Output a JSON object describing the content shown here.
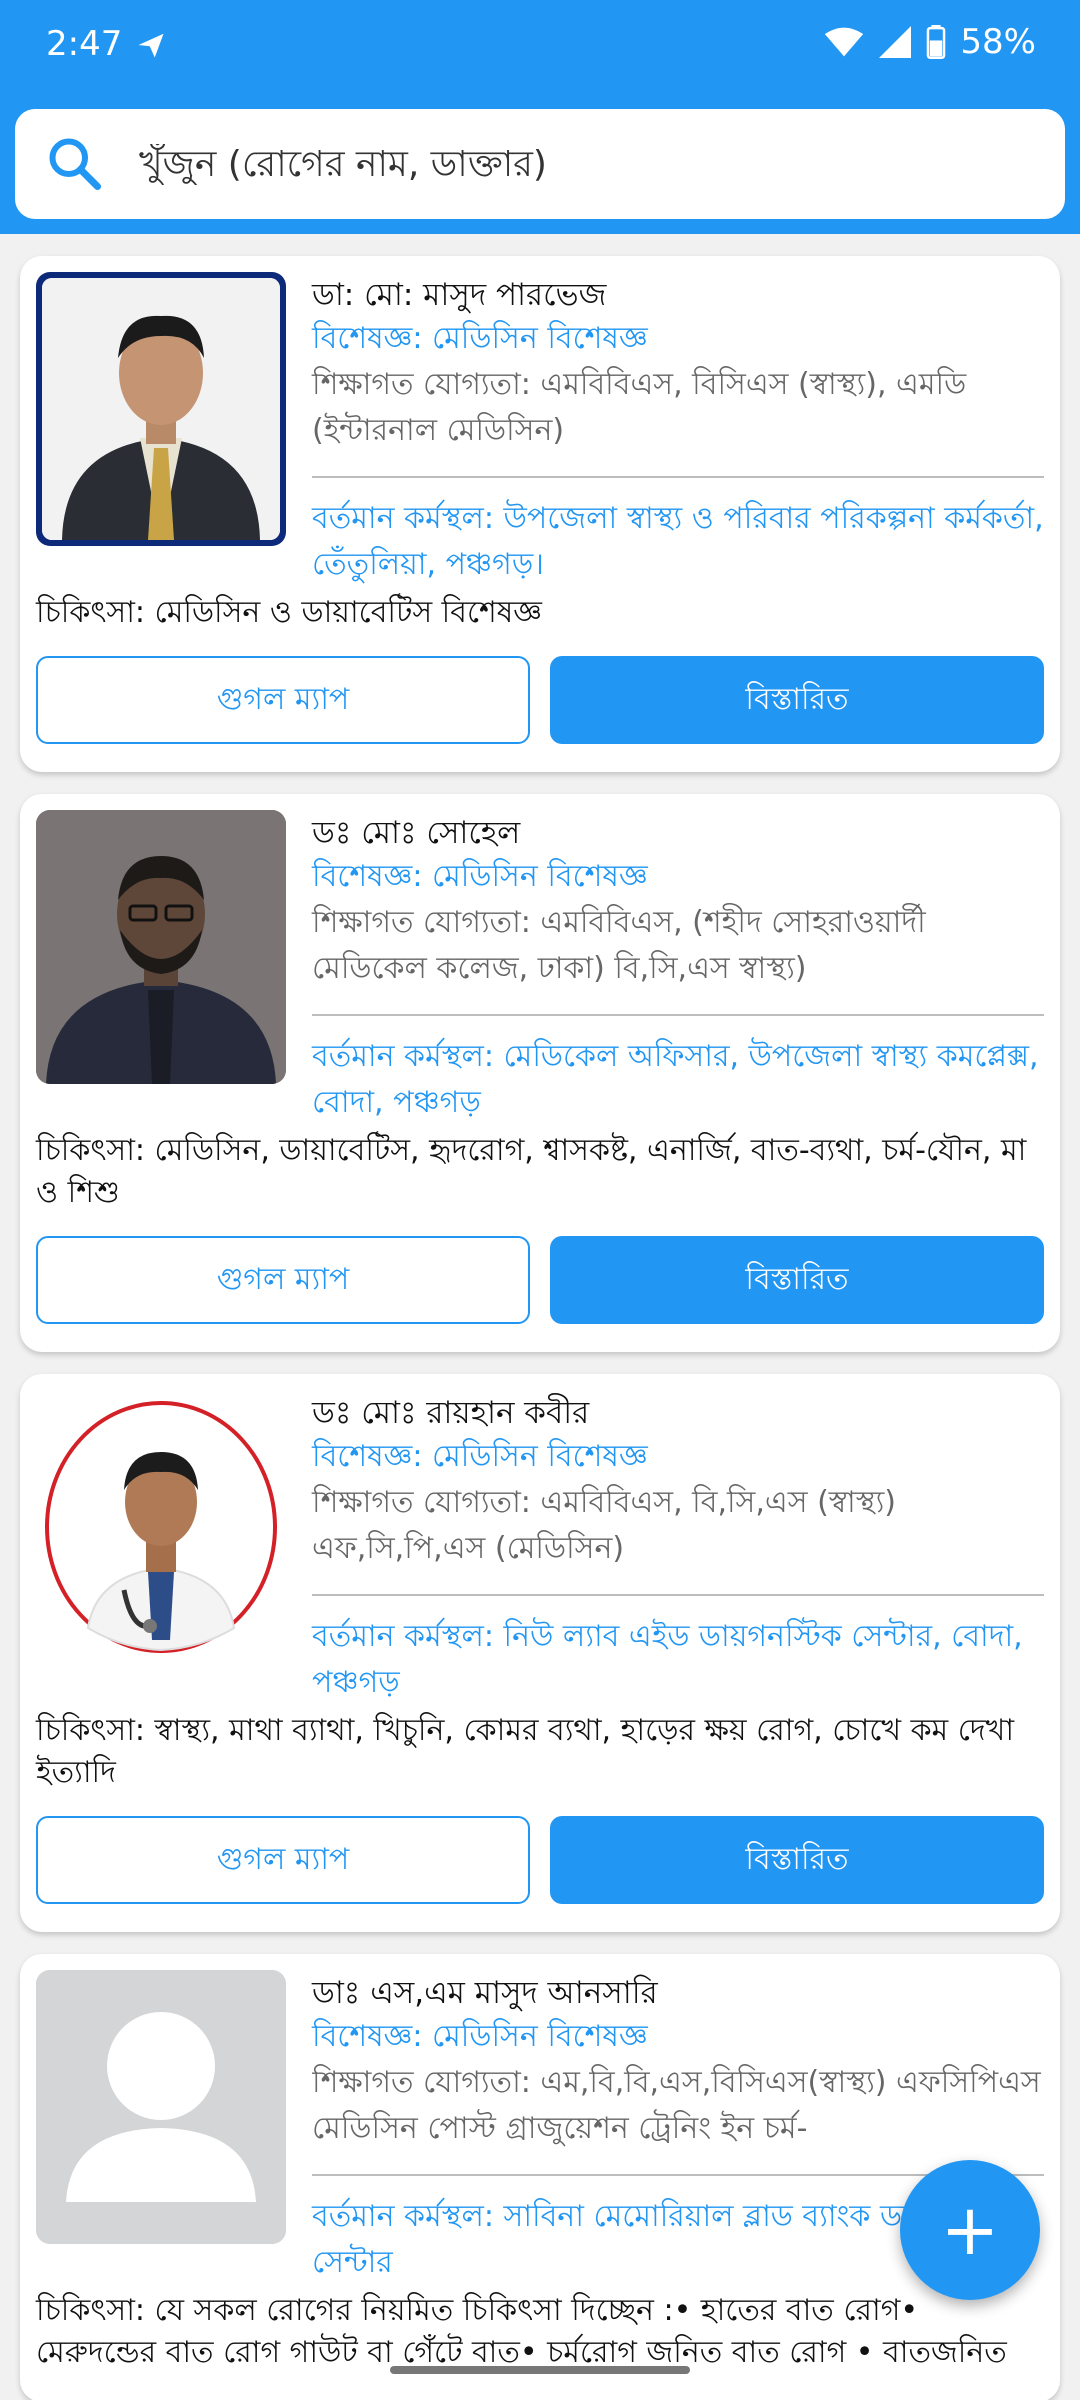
{
  "status_bar": {
    "time": "2:47",
    "battery": "58%"
  },
  "search": {
    "placeholder": "খুঁজুন (রোগের নাম, ডাক্তার)"
  },
  "doctors": [
    {
      "name": "ডা: মো: মাসুদ পারভেজ",
      "specialty": "বিশেষজ্ঞ: মেডিসিন বিশেষজ্ঞ",
      "education": "শিক্ষাগত যোগ্যতা: এমবিবিএস, বিসিএস (স্বাস্থ্য), এমডি (ইন্টারনাল মেডিসিন)",
      "workplace": "বর্তমান কর্মস্থল: উপজেলা স্বাস্থ্য ও পরিবার পরিকল্পনা কর্মকর্তা, তেঁতুলিয়া, পঞ্চগড়।",
      "treatment": "চিকিৎসা: মেডিসিন ও ডায়াবেটিস বিশেষজ্ঞ"
    },
    {
      "name": "ডঃ মোঃ সোহেল",
      "specialty": "বিশেষজ্ঞ: মেডিসিন বিশেষজ্ঞ",
      "education": "শিক্ষাগত যোগ্যতা: এমবিবিএস, (শহীদ সোহরাওয়ার্দী মেডিকেল কলেজ, ঢাকা) বি,সি,এস স্বাস্থ্য)",
      "workplace": "বর্তমান কর্মস্থল: মেডিকেল অফিসার, উপজেলা স্বাস্থ্য কমপ্লেক্স, বোদা, পঞ্চগড়",
      "treatment": "চিকিৎসা: মেডিসিন, ডায়াবেটিস, হৃদরোগ, শ্বাসকষ্ট, এনার্জি, বাত-ব্যথা, চর্ম-যৌন, মা ও শিশু"
    },
    {
      "name": "ডঃ মোঃ রায়হান কবীর",
      "specialty": "বিশেষজ্ঞ: মেডিসিন বিশেষজ্ঞ",
      "education": "শিক্ষাগত যোগ্যতা: এমবিবিএস, বি,সি,এস (স্বাস্থ্য) এফ,সি,পি,এস (মেডিসিন)",
      "workplace": "বর্তমান কর্মস্থল: নিউ ল্যাব এইড ডায়গনস্টিক সেন্টার, বোদা, পঞ্চগড়",
      "treatment": "চিকিৎসা: স্বাস্থ্য, মাথা ব্যাথা, খিচুনি, কোমর ব্যথা, হাড়ের ক্ষয় রোগ, চোখে কম দেখা ইত্যাদি"
    },
    {
      "name": "ডাঃ এস,এম মাসুদ আনসারি",
      "specialty": "বিশেষজ্ঞ: মেডিসিন বিশেষজ্ঞ",
      "education": "শিক্ষাগত যোগ্যতা: এম,বি,বি,এস,বিসিএস(স্বাস্থ্য) এফসিপিএস মেডিসিন পোস্ট গ্রাজুয়েশন ট্রেনিং ইন চর্ম-",
      "workplace": "বর্তমান কর্মস্থল: সাবিনা মেমোরিয়াল ব্লাড ব্যাংক ডায়াগনস্টিক সেন্টার",
      "treatment": "চিকিৎসা: যে সকল রোগের নিয়মিত চিকিৎসা দিচ্ছেন :• হাতের বাত রোগ• মেরুদন্ডের বাত রোগ গাউট বা গেঁটে বাত• চর্মরোগ জনিত বাত রোগ • বাতজনিত"
    }
  ],
  "buttons": {
    "map": "গুগল ম্যাপ",
    "details": "বিস্তারিত"
  },
  "fab": {
    "label": "+"
  }
}
